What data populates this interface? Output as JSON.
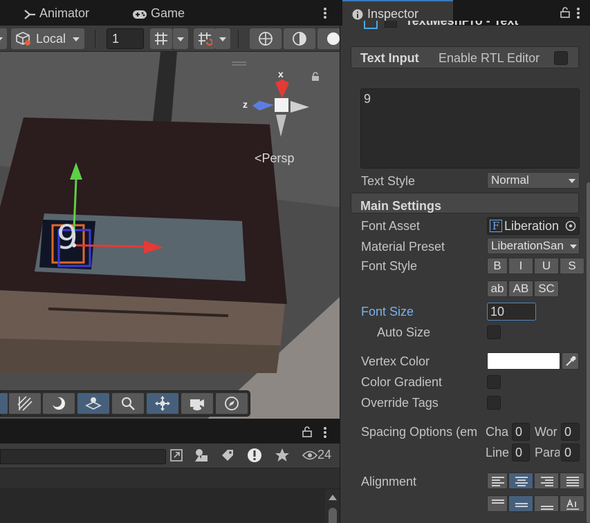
{
  "left_tabs": [
    {
      "label": "Animator"
    },
    {
      "label": "Game"
    }
  ],
  "scene_toolbar": {
    "pivot_mode": "Local",
    "grid_value": "1"
  },
  "viewport": {
    "axis_x": "x",
    "axis_z": "z",
    "projection": "Persp",
    "text_mesh": "9"
  },
  "bottom_toolbar": {
    "hidden_count": "24"
  },
  "inspector": {
    "tab_label": "Inspector",
    "component_title": "TextMeshPro - Text",
    "text_input": {
      "header": "Text Input",
      "rtl_label": "Enable RTL Editor",
      "value": "9"
    },
    "text_style": {
      "label": "Text Style",
      "value": "Normal"
    },
    "main_settings": {
      "header": "Main Settings",
      "font_asset": {
        "label": "Font Asset",
        "value": "Liberation"
      },
      "material_preset": {
        "label": "Material Preset",
        "value": "LiberationSan"
      },
      "font_style": {
        "label": "Font Style",
        "row1": [
          "B",
          "I",
          "U",
          "S"
        ],
        "row2": [
          "ab",
          "AB",
          "SC"
        ]
      },
      "font_size": {
        "label": "Font Size",
        "value": "10"
      },
      "auto_size": {
        "label": "Auto Size"
      },
      "vertex_color": {
        "label": "Vertex Color",
        "color": "#ffffff"
      },
      "color_gradient": {
        "label": "Color Gradient"
      },
      "override_tags": {
        "label": "Override Tags"
      },
      "spacing": {
        "label": "Spacing Options (em",
        "char_label": "Cha",
        "char_value": "0",
        "word_label": "Wor",
        "word_value": "0",
        "line_label": "Line",
        "line_value": "0",
        "para_label": "Para",
        "para_value": "0"
      },
      "alignment": {
        "label": "Alignment"
      }
    }
  },
  "colors": {
    "accent": "#3a79bb",
    "selected": "#46607c",
    "focus_label": "#7cb1ea"
  }
}
